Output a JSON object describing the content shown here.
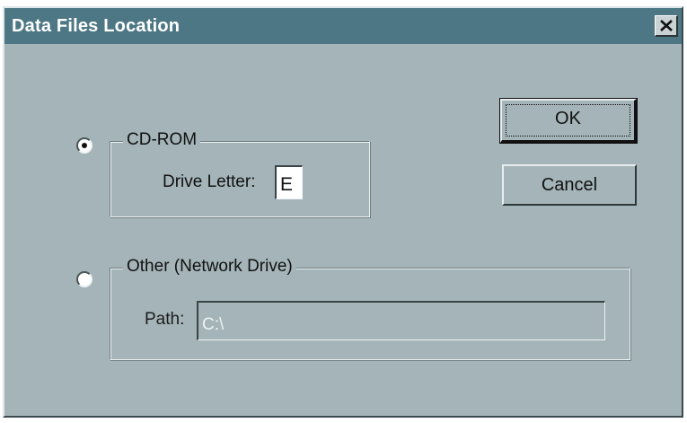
{
  "dialog": {
    "title": "Data Files Location",
    "close_glyph": "✕"
  },
  "buttons": {
    "ok_label": "OK",
    "cancel_label": "Cancel"
  },
  "cdrom": {
    "group_label": "CD-ROM",
    "drive_letter_label": "Drive Letter:",
    "drive_letter_value": "E",
    "selected": true
  },
  "other": {
    "group_label": "Other (Network Drive)",
    "path_label": "Path:",
    "path_value": "C:\\",
    "selected": false,
    "enabled": false
  },
  "colors": {
    "titlebar": "#4d7784",
    "dialog_face": "#a4b4b8",
    "disabled_text": "#eef3f4"
  }
}
